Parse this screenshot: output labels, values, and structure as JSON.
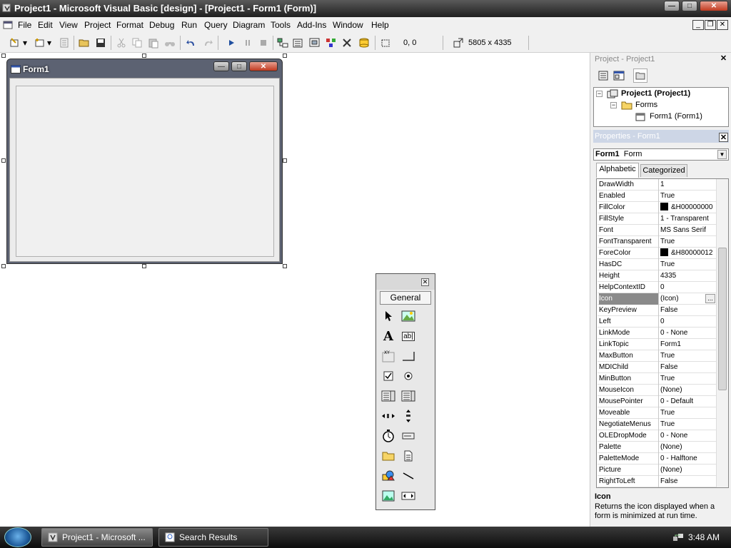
{
  "title": "Project1 - Microsoft Visual Basic [design] - [Project1 - Form1 (Form)]",
  "menu": [
    "File",
    "Edit",
    "View",
    "Project",
    "Format",
    "Debug",
    "Run",
    "Query",
    "Diagram",
    "Tools",
    "Add-Ins",
    "Window",
    "Help"
  ],
  "toolbar": {
    "position": "0, 0",
    "size": "5805 x 4335"
  },
  "form": {
    "caption": "Form1"
  },
  "toolbox": {
    "tab": "General"
  },
  "project": {
    "header": "Project - Project1",
    "root": "Project1 (Project1)",
    "folder": "Forms",
    "item": "Form1 (Form1)"
  },
  "properties": {
    "header": "Properties - Form1",
    "object_name": "Form1",
    "object_type": "Form",
    "tabs": [
      "Alphabetic",
      "Categorized"
    ],
    "rows": [
      {
        "name": "DrawWidth",
        "value": "1"
      },
      {
        "name": "Enabled",
        "value": "True"
      },
      {
        "name": "FillColor",
        "value": "&H00000000"
      },
      {
        "name": "FillStyle",
        "value": "1 - Transparent"
      },
      {
        "name": "Font",
        "value": "MS Sans Serif"
      },
      {
        "name": "FontTransparent",
        "value": "True"
      },
      {
        "name": "ForeColor",
        "value": "&H80000012"
      },
      {
        "name": "HasDC",
        "value": "True"
      },
      {
        "name": "Height",
        "value": "4335"
      },
      {
        "name": "HelpContextID",
        "value": "0"
      },
      {
        "name": "Icon",
        "value": "(Icon)"
      },
      {
        "name": "KeyPreview",
        "value": "False"
      },
      {
        "name": "Left",
        "value": "0"
      },
      {
        "name": "LinkMode",
        "value": "0 - None"
      },
      {
        "name": "LinkTopic",
        "value": "Form1"
      },
      {
        "name": "MaxButton",
        "value": "True"
      },
      {
        "name": "MDIChild",
        "value": "False"
      },
      {
        "name": "MinButton",
        "value": "True"
      },
      {
        "name": "MouseIcon",
        "value": "(None)"
      },
      {
        "name": "MousePointer",
        "value": "0 - Default"
      },
      {
        "name": "Moveable",
        "value": "True"
      },
      {
        "name": "NegotiateMenus",
        "value": "True"
      },
      {
        "name": "OLEDropMode",
        "value": "0 - None"
      },
      {
        "name": "Palette",
        "value": "(None)"
      },
      {
        "name": "PaletteMode",
        "value": "0 - Halftone"
      },
      {
        "name": "Picture",
        "value": "(None)"
      },
      {
        "name": "RightToLeft",
        "value": "False"
      }
    ],
    "desc_title": "Icon",
    "desc_text": "Returns the icon displayed when a form is minimized at run time."
  },
  "taskbar": {
    "items": [
      "Project1 - Microsoft ...",
      "Search Results"
    ],
    "clock": "3:48 AM"
  }
}
